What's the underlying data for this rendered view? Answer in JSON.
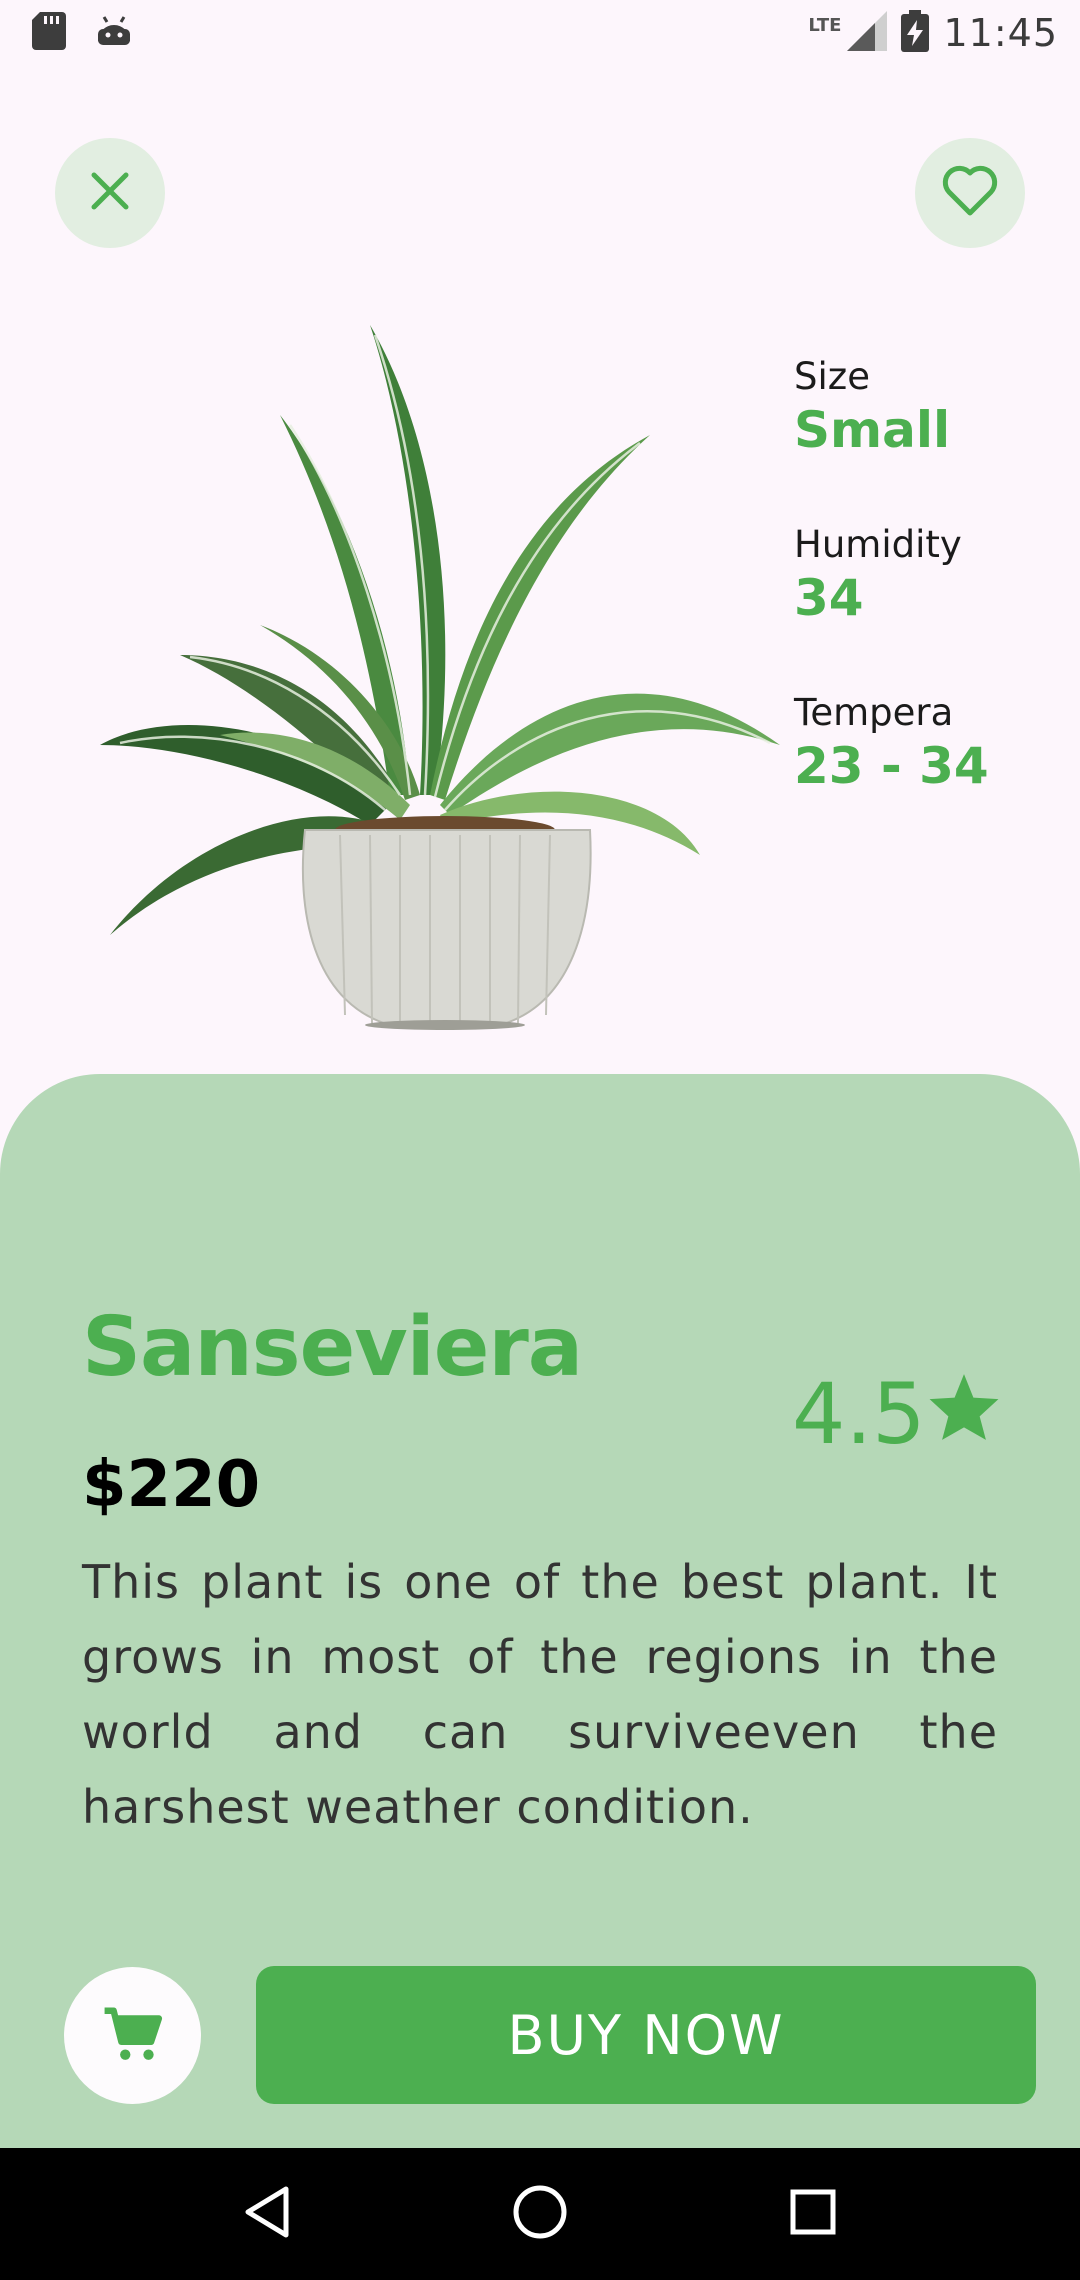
{
  "status_bar": {
    "time": "11:45",
    "network": "LTE",
    "left_icons": [
      "sd-card-icon",
      "android-icon"
    ],
    "right_icons": [
      "signal-icon",
      "battery-charging-icon"
    ]
  },
  "top_actions": {
    "close_icon": "close-icon",
    "favorite_icon": "heart-outline-icon"
  },
  "specs": [
    {
      "label": "Size",
      "value": "Small"
    },
    {
      "label": "Humidity",
      "value": "34"
    },
    {
      "label": "Tempera",
      "value": "23 - 34"
    }
  ],
  "product": {
    "name": "Sanseviera",
    "rating": "4.5",
    "price": "$220",
    "description": "This plant is one of the best plant. It grows in most of the regions in the world and can surviveeven the harshest weather condition."
  },
  "actions": {
    "buy_label": "BUY NOW",
    "cart_icon": "cart-icon"
  },
  "nav_bar": {
    "icons": [
      "back-icon",
      "home-icon",
      "recents-icon"
    ]
  },
  "colors": {
    "accent": "#4caf50",
    "sheet": "#b5d8b7",
    "background": "#fdf6fc",
    "button_bg": "#e2eee1"
  }
}
